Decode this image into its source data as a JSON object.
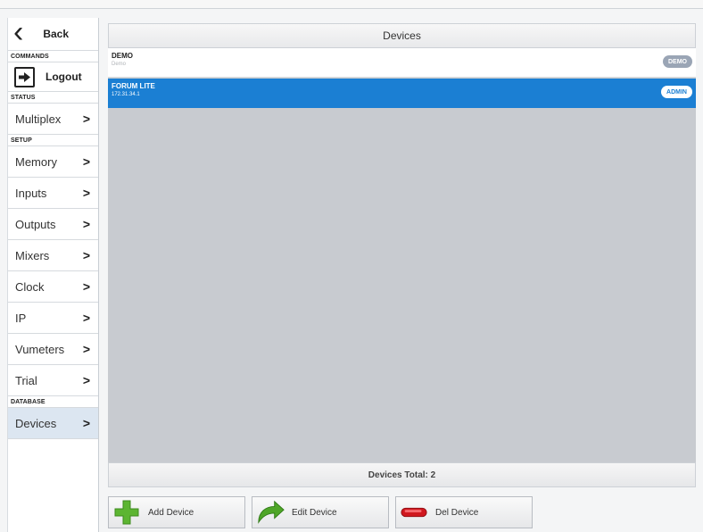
{
  "sidebar": {
    "back_label": "Back",
    "sections": {
      "commands": "COMMANDS",
      "status": "STATUS",
      "setup": "SETUP",
      "database": "DATABASE"
    },
    "logout_label": "Logout",
    "status_items": [
      {
        "label": "Multiplex"
      }
    ],
    "setup_items": [
      {
        "label": "Memory"
      },
      {
        "label": "Inputs"
      },
      {
        "label": "Outputs"
      },
      {
        "label": "Mixers"
      },
      {
        "label": "Clock"
      },
      {
        "label": "IP"
      },
      {
        "label": "Vumeters"
      },
      {
        "label": "Trial"
      }
    ],
    "database_items": [
      {
        "label": "Devices",
        "selected": true
      }
    ],
    "chevron": ">"
  },
  "main": {
    "title": "Devices",
    "devices": [
      {
        "name": "DEMO",
        "subtitle": "Demo",
        "badge": "DEMO",
        "selected": false
      },
      {
        "name": "FORUM LITE",
        "subtitle": "172.31.34.1",
        "badge": "ADMIN",
        "selected": true
      }
    ],
    "footer": "Devices Total: 2"
  },
  "toolbar": {
    "add_label": "Add Device",
    "edit_label": "Edit Device",
    "del_label": "Del Device"
  },
  "colors": {
    "selection": "#1b7fd3",
    "add_icon": "#5cb531",
    "edit_icon": "#4fa628",
    "del_icon": "#d0181f"
  },
  "icons": {
    "back": "chevron-left-icon",
    "logout": "arrow-right-icon",
    "nav": "chevron-right-icon",
    "add": "green-plus-icon",
    "edit": "green-curved-arrow-icon",
    "del": "red-minus-icon"
  }
}
